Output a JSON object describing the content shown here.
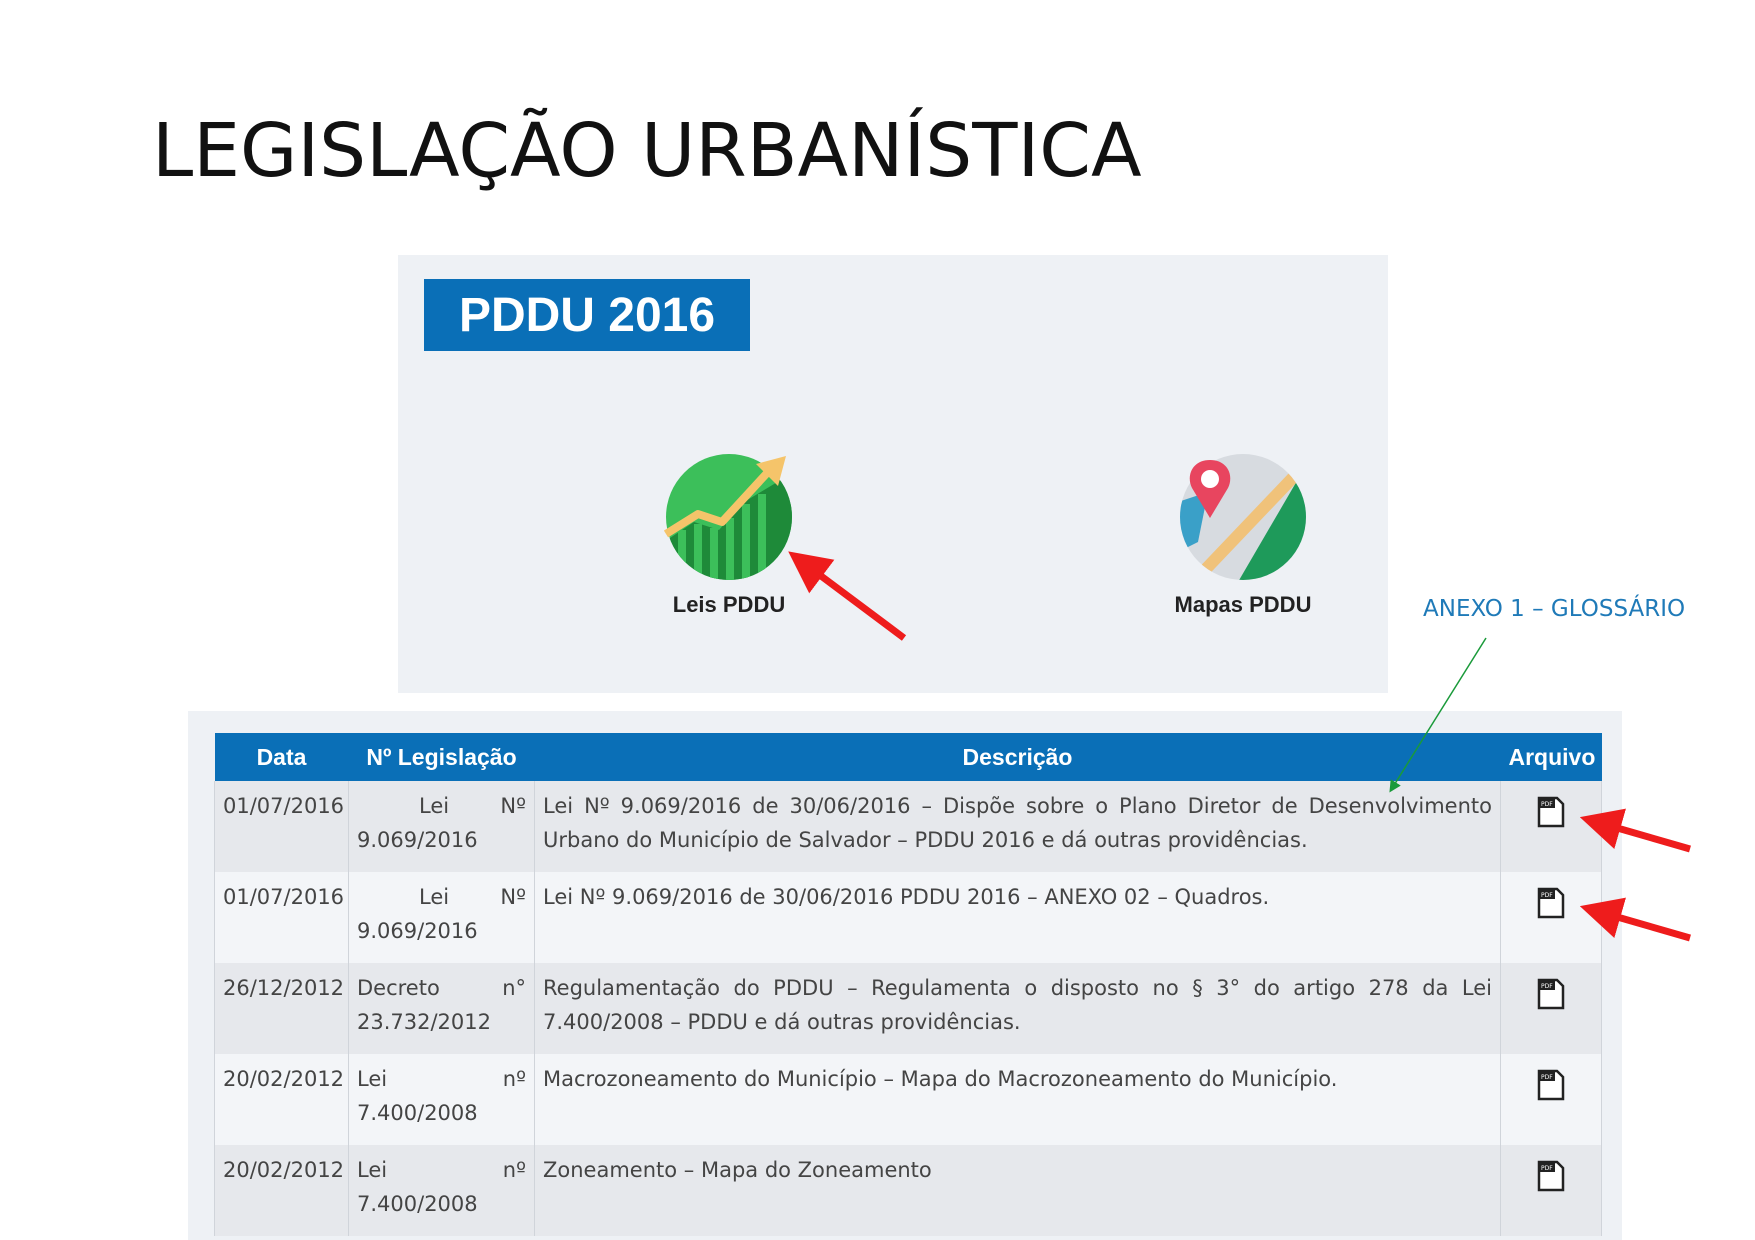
{
  "title": "LEGISLAÇÃO URBANÍSTICA",
  "panel": {
    "badge": "PDDU 2016",
    "apps": [
      {
        "label": "Leis PDDU",
        "icon": "growth-chart-icon"
      },
      {
        "label": "Mapas PDDU",
        "icon": "map-pin-icon"
      }
    ]
  },
  "annotation": {
    "text": "ANEXO 1 – GLOSSÁRIO",
    "color": "#1f7ab8"
  },
  "table": {
    "headers": [
      "Data",
      "Nº Legislação",
      "Descrição",
      "Arquivo"
    ],
    "rows": [
      {
        "date": "01/07/2016",
        "type": "Lei",
        "abbr": "Nº",
        "number": "9.069/2016",
        "description": "Lei Nº 9.069/2016 de 30/06/2016 – Dispõe sobre o Plano Diretor de Desenvolvimento Urbano do Município de Salvador – PDDU 2016 e dá outras providências.",
        "file_icon": "pdf-icon"
      },
      {
        "date": "01/07/2016",
        "type": "Lei",
        "abbr": "Nº",
        "number": "9.069/2016",
        "description": "Lei Nº 9.069/2016 de 30/06/2016 PDDU 2016 – ANEXO 02 – Quadros.",
        "file_icon": "pdf-icon"
      },
      {
        "date": "26/12/2012",
        "type": "Decreto",
        "abbr": "n°",
        "number": "23.732/2012",
        "description": "Regulamentação do PDDU – Regulamenta o disposto no § 3° do artigo 278 da Lei 7.400/2008 – PDDU e dá outras providências.",
        "file_icon": "pdf-icon"
      },
      {
        "date": "20/02/2012",
        "type": "Lei",
        "abbr": "nº",
        "number": "7.400/2008",
        "description": "Macrozoneamento do Município – Mapa do Macrozoneamento do Município.",
        "file_icon": "pdf-icon"
      },
      {
        "date": "20/02/2012",
        "type": "Lei",
        "abbr": "nº",
        "number": "7.400/2008",
        "description": "Zoneamento – Mapa do Zoneamento",
        "file_icon": "pdf-icon"
      }
    ]
  },
  "colors": {
    "header_blue": "#0a6fb7",
    "arrow_red": "#ee1c1c",
    "pointer_green": "#1a9a3a"
  }
}
